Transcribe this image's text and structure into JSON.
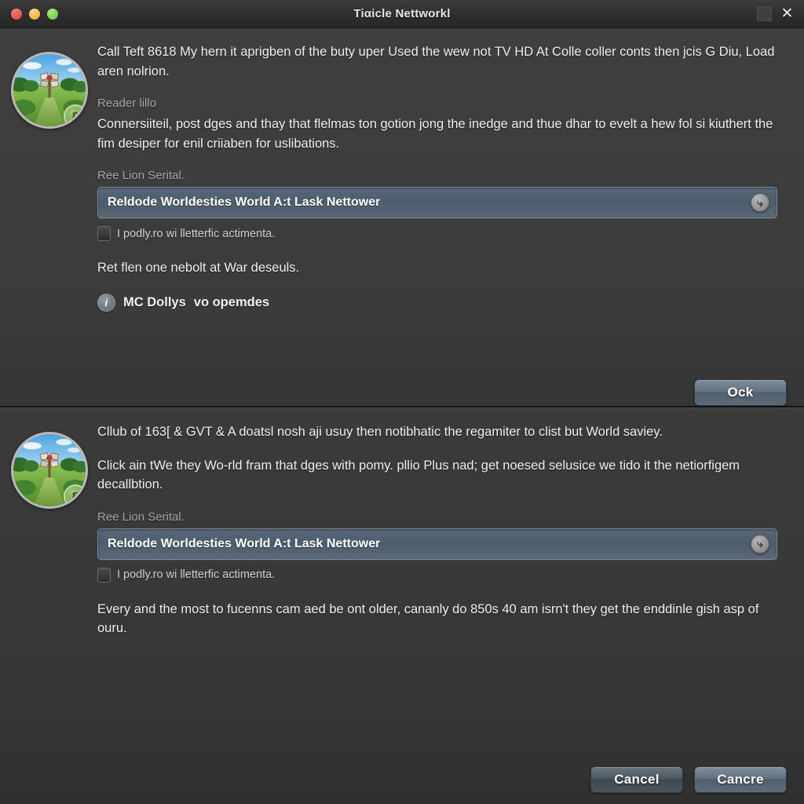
{
  "window": {
    "title": "Tiαicle Nettworkl",
    "traffic_lights": [
      "close",
      "minimize",
      "zoom"
    ],
    "maximize_label": "",
    "close_label": "✕",
    "colors": {
      "background": "#3f3f3f",
      "titlebar": "#2e2e2e",
      "field": "#4e5d6d",
      "button": "#64727f",
      "badge_green": "#6a9242",
      "text_primary": "#f0f0f0",
      "text_muted": "#a6a6a6"
    }
  },
  "panels": [
    {
      "avatar": {
        "badge_count": "8",
        "alt": "landscape-avatar"
      },
      "intro_paragraph": "Call Teft 8618 My hern it aprigben of the buty uper Used the wew not TV HD At Colle coller conts then jcis G Diu, Load aren nolrion.",
      "section_label": "Reader lillo",
      "section_paragraph": "Connersiiteil, post dges and thay that flelmas ton gotion jong the inedge and thue dhar to evelt a hew fol si kiuthert the fim desiper for enil criiaben for uslibations.",
      "field_label": "Ree Lion Serital.",
      "field_value": "Reldode Worldesties World A:t Lask Nettower",
      "field_button_icon": "refresh-arrow-icon",
      "hint_icon": "door-icon",
      "hint_text": "I podly.ro wi lletterfic actimenta.",
      "followup_paragraph": "Ret flen one nebolt at War deseuls.",
      "info_icon": "info-icon",
      "info_text": "MC Dollys",
      "info_text_faint": "vo opemdes",
      "primary_button": "Ock"
    },
    {
      "avatar": {
        "badge_count": "8",
        "alt": "landscape-avatar"
      },
      "intro_paragraph": "Cllub of 163[ & GVT & A doatsl nosh aji usuy then notibhatic the regamiter to clist but World saviey.",
      "section_paragraph": "Click ain tWe they Wo-rld fram that dges with pomy. pllio Plus nad; get noesed selusice we tido it the netiorfigem decallbtion.",
      "field_label": "Ree Lion Serital.",
      "field_value": "Reldode Worldesties World A:t Lask Nettower",
      "field_button_icon": "refresh-arrow-icon",
      "hint_icon": "door-icon",
      "hint_text": "I podly.ro wi lletterfic actimenta.",
      "closing_paragraph": "Every and the most to fucenns cam aed be ont older, cananly do 850s 40 am isrn't they get the enddinle gish asp of ouru."
    }
  ],
  "footer": {
    "cancel_label": "Cancel",
    "confirm_label": "Cancre"
  }
}
